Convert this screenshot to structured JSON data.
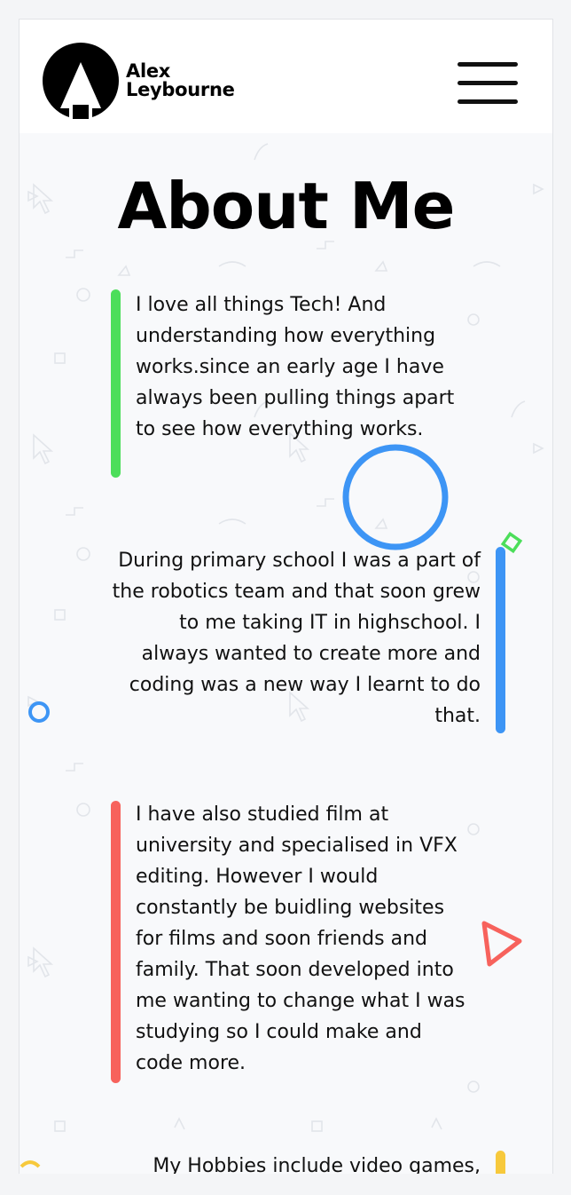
{
  "header": {
    "brand_line1": "Alex",
    "brand_line2": "Leybourne",
    "menu_icon": "hamburger-menu-icon"
  },
  "about": {
    "title": "About Me",
    "paragraphs": [
      {
        "text": "I love all things Tech! And understanding how everything works.since an early age I have always been pulling things apart to see how everything works.",
        "accent": "#4cde5a",
        "align": "left"
      },
      {
        "text": "During primary school I was a part of the robotics team and that soon grew to me taking IT in highschool. I always wanted to create more and coding was a new way I learnt to do that.",
        "accent": "#3d95f5",
        "align": "right"
      },
      {
        "text": "I have also studied film at university and specialised in VFX editing. However I would constantly be buidling websites for films and soon friends and family. That soon developed into me wanting to change what I was studying so I could make and code more.",
        "accent": "#f7625c",
        "align": "left"
      },
      {
        "text": "My Hobbies include video games,",
        "accent": "#f7c93c",
        "align": "right"
      }
    ]
  },
  "colors": {
    "green": "#4cde5a",
    "blue": "#3d95f5",
    "red": "#f7625c",
    "yellow": "#f7c93c",
    "text": "#111111",
    "background": "#f8f9fb"
  },
  "decorations": [
    "circle-outline-blue",
    "diamond-outline-green",
    "triangle-outline-red",
    "small-circle-blue",
    "arc-yellow"
  ]
}
